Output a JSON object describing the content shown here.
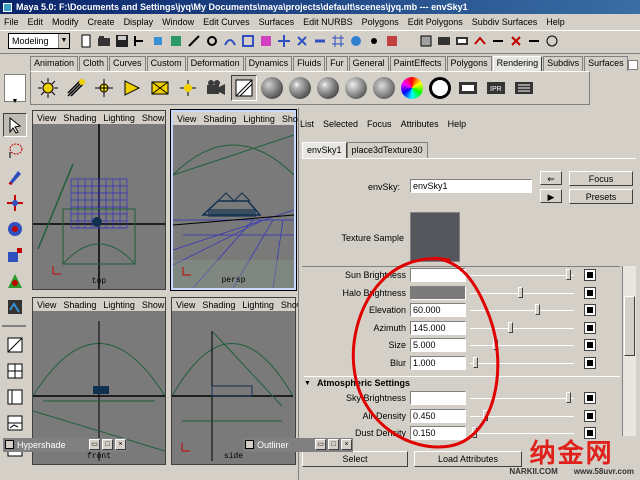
{
  "window": {
    "title": "Maya 5.0: F:\\Documents and Settings\\jyq\\My Documents\\maya\\projects\\default\\scenes\\jyq.mb  ---  envSky1"
  },
  "menubar": {
    "items": [
      "File",
      "Edit",
      "Modify",
      "Create",
      "Display",
      "Window",
      "Edit Curves",
      "Surfaces",
      "Edit NURBS",
      "Polygons",
      "Edit Polygons",
      "Subdiv Surfaces",
      "Help"
    ]
  },
  "statusline": {
    "mode": "Modeling"
  },
  "shelf": {
    "tabs": [
      "Animation",
      "Cloth",
      "Curves",
      "Custom",
      "Deformation",
      "Dynamics",
      "Fluids",
      "Fur",
      "General",
      "PaintEffects",
      "Polygons",
      "Rendering",
      "Subdivs",
      "Surfaces"
    ],
    "active_tab": "Rendering"
  },
  "viewports": {
    "menu": [
      "View",
      "Shading",
      "Lighting",
      "Show"
    ],
    "top": {
      "label": "top"
    },
    "persp": {
      "label": "persp"
    },
    "front": {
      "label": "front"
    },
    "side": {
      "label": "side"
    }
  },
  "attribute_editor": {
    "menu": [
      "List",
      "Selected",
      "Focus",
      "Attributes",
      "Help"
    ],
    "tabs": [
      "envSky1",
      "place3dTexture30"
    ],
    "node_label": "envSky:",
    "node_name": "envSky1",
    "focus_label": "Focus",
    "presets_label": "Presets",
    "texture_sample_label": "Texture Sample",
    "attributes": [
      {
        "label": "Sun Brightness",
        "value": "",
        "slider": 0.98
      },
      {
        "label": "Halo Brightness",
        "value": "",
        "slider": 0.5
      },
      {
        "label": "Elevation",
        "value": "60.000",
        "slider": 0.67
      },
      {
        "label": "Azimuth",
        "value": "145.000",
        "slider": 0.4
      },
      {
        "label": "Size",
        "value": "5.000",
        "slider": 0.25
      },
      {
        "label": "Blur",
        "value": "1.000",
        "slider": 0.05
      }
    ],
    "section_title": "Atmospheric Settings",
    "atmos_attributes": [
      {
        "label": "Sky Brightness",
        "value": "",
        "slider": 0.98
      },
      {
        "label": "Air Density",
        "value": "0.450",
        "slider": 0.15
      },
      {
        "label": "Dust Density",
        "value": "0.150",
        "slider": 0.04
      }
    ],
    "bottom_buttons": [
      "Select",
      "Load Attributes"
    ]
  },
  "floating_windows": {
    "hypershade": "Hypershade",
    "outliner": "Outliner"
  },
  "watermark": {
    "text": "纳金网",
    "url": "NARKII.COM",
    "url2": "www.58uvr.com"
  },
  "colors": {
    "title_bar": "#0a246a",
    "viewport_bg": "#7a7a7a",
    "wire": "#1f5f3a",
    "annotation": "#e00000"
  }
}
